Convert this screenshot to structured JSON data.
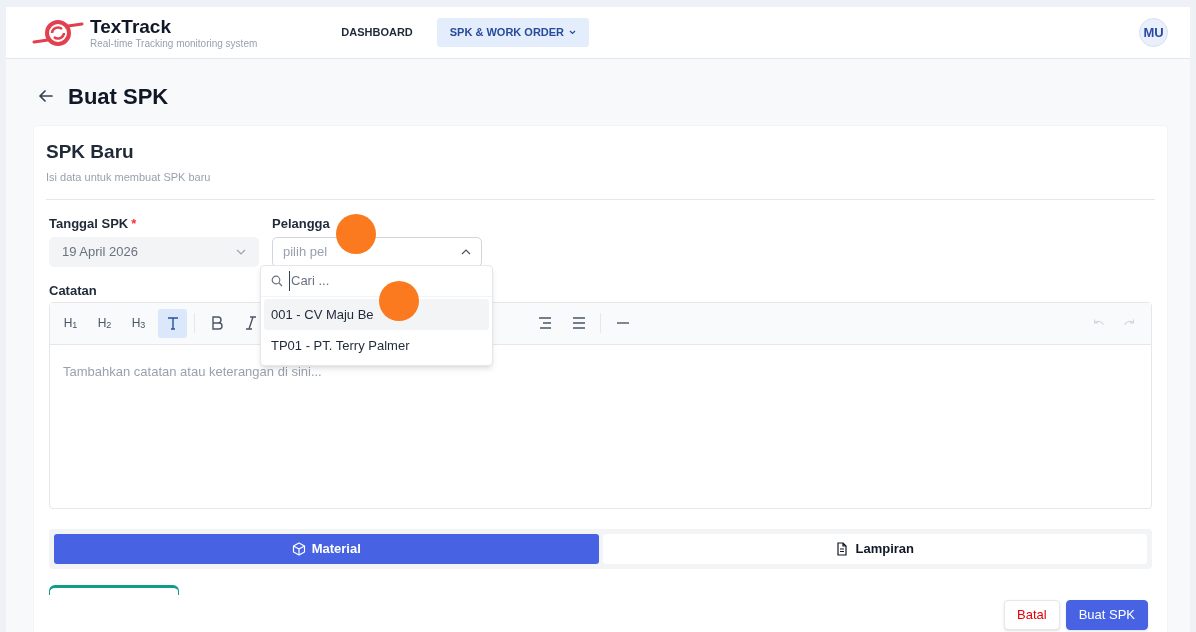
{
  "app": {
    "name": "TexTrack",
    "tagline": "Real-time Tracking monitoring system"
  },
  "nav": [
    {
      "label": "DASHBOARD",
      "selected": false,
      "has_menu": false
    },
    {
      "label": "SPK & WORK ORDER",
      "selected": true,
      "has_menu": true
    }
  ],
  "user": {
    "initials": "MU"
  },
  "page": {
    "title": "Buat SPK"
  },
  "card": {
    "title": "SPK Baru",
    "subtitle": "Isi data untuk membuat SPK baru"
  },
  "date_field": {
    "label": "Tanggal SPK",
    "required_mark": "*",
    "value": "19 April 2026",
    "disabled": true
  },
  "customer_field": {
    "label": "Pelangga",
    "placeholder": "pilih pel",
    "expanded": true
  },
  "dropdown": {
    "search_placeholder": "Cari ...",
    "options": [
      {
        "label": "001 - CV Maju Be",
        "selected": true
      },
      {
        "label": "TP01 - PT. Terry Palmer",
        "selected": false
      }
    ]
  },
  "notes": {
    "label": "Catatan",
    "placeholder": "Tambahkan catatan atau keterangan di sini...",
    "toolbar": [
      {
        "kind": "heading",
        "label": "H$_{1}$",
        "selected": false
      },
      {
        "kind": "heading",
        "label": "H$_{2}$",
        "selected": false
      },
      {
        "kind": "heading",
        "label": "H$_{3}$",
        "selected": false
      },
      {
        "kind": "paragraph",
        "selected": true
      },
      {
        "kind": "separator"
      },
      {
        "kind": "bold",
        "selected": false
      },
      {
        "kind": "italic",
        "selected": false
      },
      {
        "kind": "hidden"
      },
      {
        "kind": "align-right",
        "selected": false
      },
      {
        "kind": "justify",
        "selected": false
      },
      {
        "kind": "separator"
      },
      {
        "kind": "rule",
        "selected": false
      }
    ],
    "history": [
      {
        "kind": "undo",
        "disabled": true
      },
      {
        "kind": "redo",
        "disabled": true
      }
    ]
  },
  "tabs": [
    {
      "label": "Material",
      "kind": "package",
      "selected": true
    },
    {
      "label": "Lampiran",
      "kind": "file",
      "selected": false
    }
  ],
  "actions": [
    {
      "label": "Batal",
      "kind": "secondary"
    },
    {
      "label": "Buat SPK",
      "kind": "primary"
    }
  ],
  "touches": [
    {
      "kind": "tap"
    },
    {
      "kind": "tap"
    }
  ]
}
